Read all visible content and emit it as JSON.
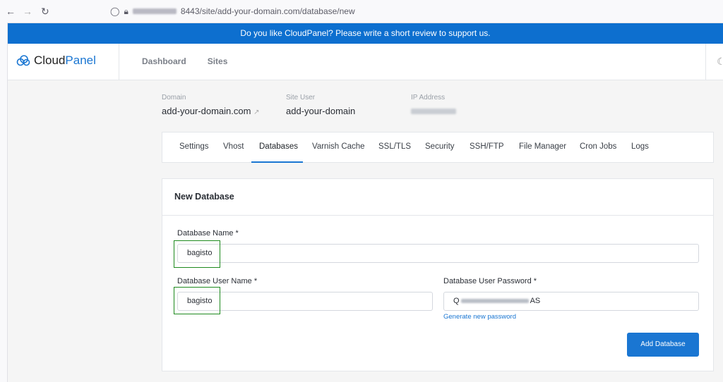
{
  "browser": {
    "back_icon": "arrow-left-icon",
    "forward_icon": "arrow-right-icon",
    "reload_icon": "reload-icon",
    "url_suffix": "8443/site/add-your-domain.com/database/new"
  },
  "banner": {
    "text": "Do you like CloudPanel? Please write a short review to support us."
  },
  "header": {
    "logo_part1": "Cloud",
    "logo_part2": "Panel",
    "nav": [
      "Dashboard",
      "Sites"
    ]
  },
  "site": {
    "domain_label": "Domain",
    "domain_value": "add-your-domain.com",
    "user_label": "Site User",
    "user_value": "add-your-domain",
    "ip_label": "IP Address"
  },
  "tabs": [
    "Settings",
    "Vhost",
    "Databases",
    "Varnish Cache",
    "SSL/TLS",
    "Security",
    "SSH/FTP",
    "File Manager",
    "Cron Jobs",
    "Logs"
  ],
  "active_tab": "Databases",
  "form": {
    "title": "New Database",
    "db_name_label": "Database Name *",
    "db_name_value": "bagisto",
    "db_user_label": "Database User Name *",
    "db_user_value": "bagisto",
    "db_pass_label": "Database User Password *",
    "db_pass_start": "Q",
    "db_pass_end": "AS",
    "generate_link": "Generate new password",
    "submit": "Add Database"
  },
  "colors": {
    "accent": "#1a76d2",
    "banner": "#0d6fcf",
    "highlight": "#1e8a1e"
  }
}
